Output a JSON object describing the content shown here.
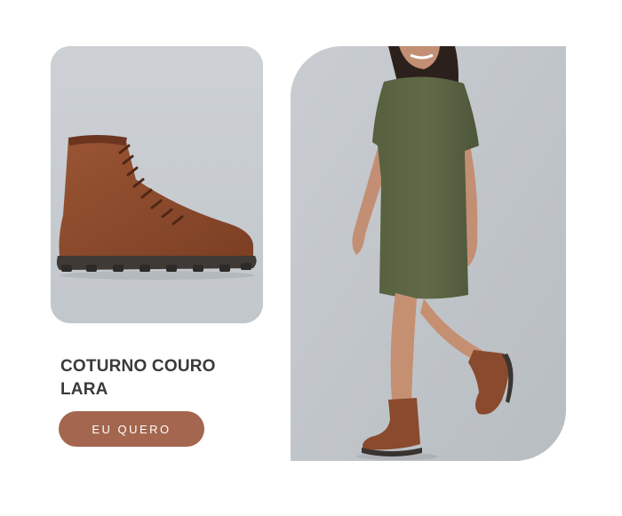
{
  "product": {
    "title": "COTURNO COURO LARA",
    "cta_label": "EU QUERO",
    "image_subject": "boot-product-image",
    "model_image_subject": "model-wearing-boots-image"
  },
  "colors": {
    "background": "#ffffff",
    "card_bg": "#c7ccd1",
    "title": "#3a3a3a",
    "button": "#a4664f",
    "button_text": "#ffffff",
    "boot_leather": "#8a4a2e",
    "dress": "#5c6445"
  }
}
